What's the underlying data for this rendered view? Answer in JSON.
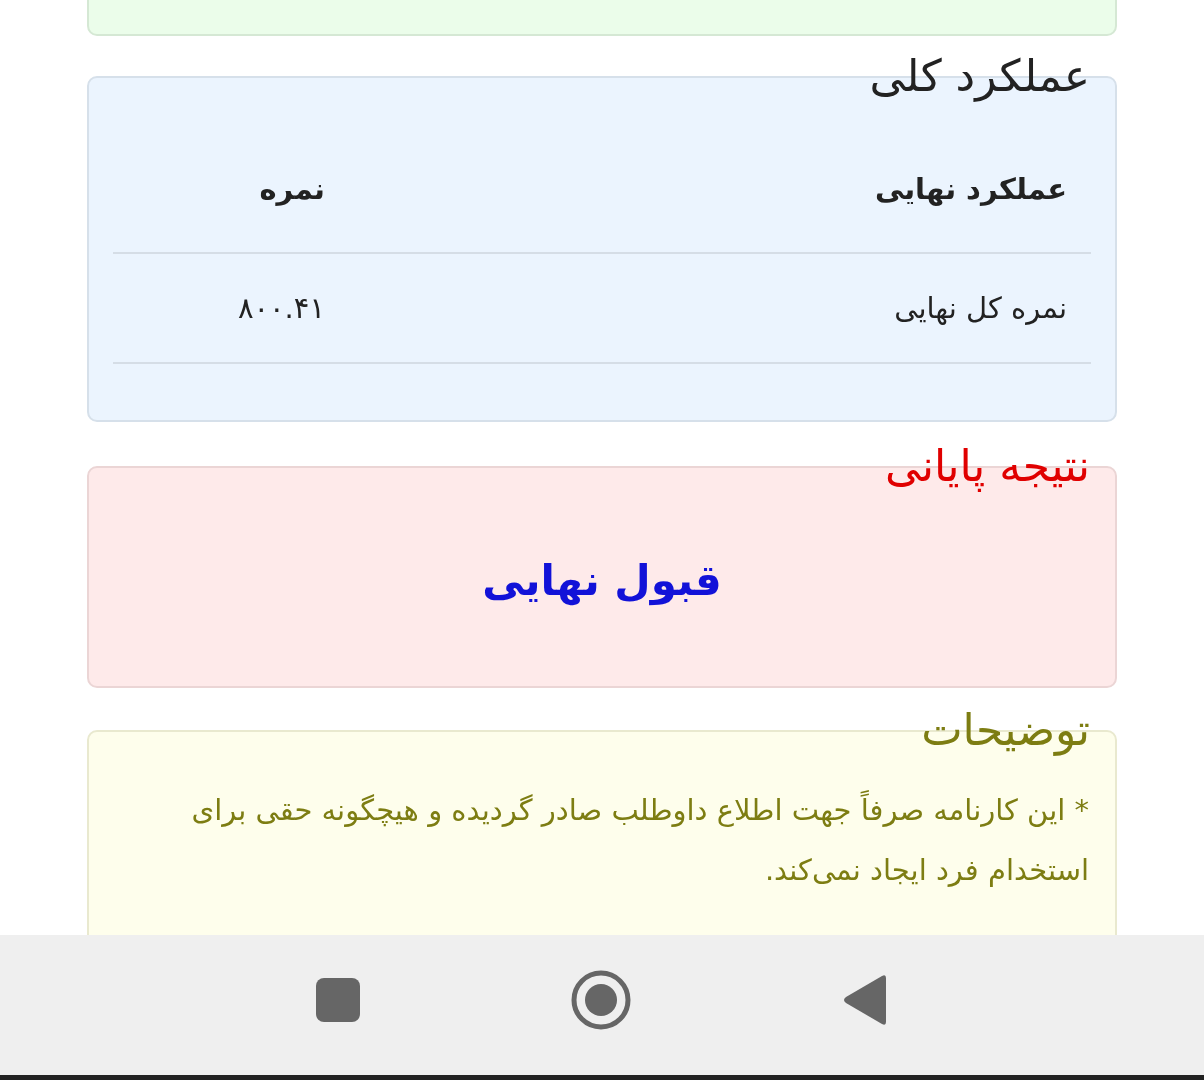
{
  "sections": [
    {
      "kind": "table",
      "title": "عملکرد کلی",
      "table": {
        "columns": [
          "عملکرد نهایی",
          "نمره"
        ],
        "rows": [
          [
            "نمره کل نهایی",
            "۸۰۰.۴۱"
          ]
        ]
      }
    },
    {
      "kind": "result",
      "title": "نتیجه پایانی",
      "result": "قبول نهایی"
    },
    {
      "kind": "notes",
      "title": "توضیحات",
      "notes": [
        "* این کارنامه صرفاً جهت اطلاع داوطلب صادر گردیده و هیچگونه حقی برای استخدام فرد ایجاد نمی‌کند."
      ]
    }
  ]
}
